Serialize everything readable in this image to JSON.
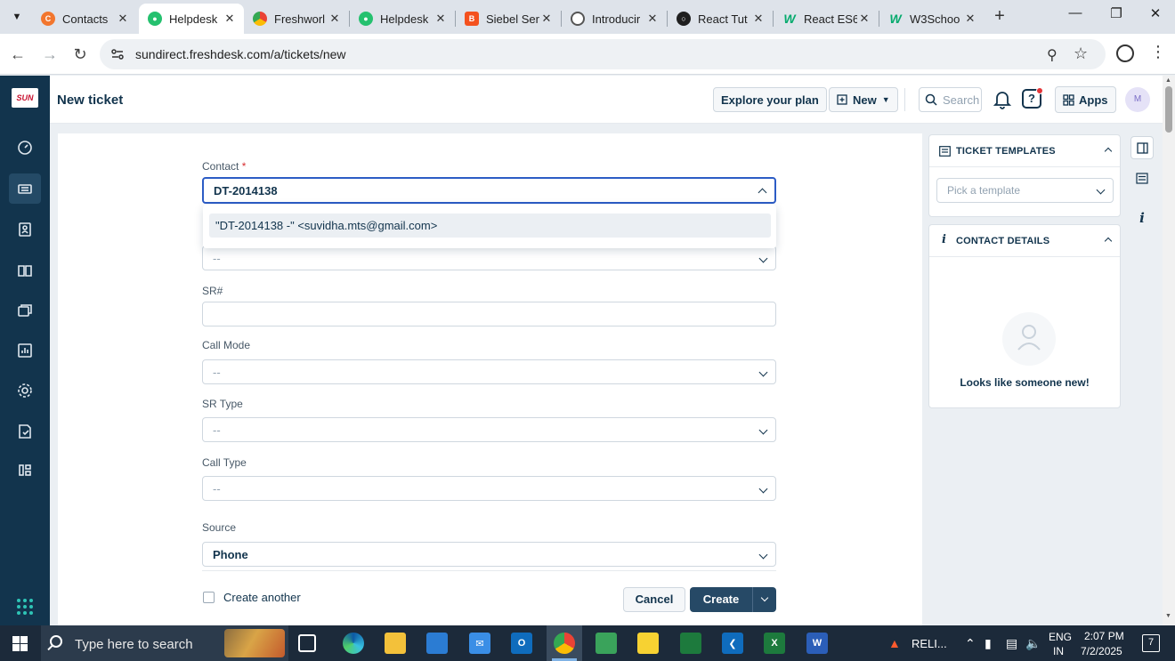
{
  "browser": {
    "tabs": [
      {
        "title": "Contacts",
        "favicon": "freshworks-orange-icon",
        "color": "#f2762e"
      },
      {
        "title": "Helpdesk",
        "favicon": "freshdesk-green-icon",
        "color": "#25c16f",
        "active": true
      },
      {
        "title": "Freshworl",
        "favicon": "chrome-color-icon",
        "color": "#4285f4"
      },
      {
        "title": "Helpdesk",
        "favicon": "freshdesk-green-icon",
        "color": "#25c16f"
      },
      {
        "title": "Siebel Ser",
        "favicon": "blogger-orange-icon",
        "color": "#f4511e"
      },
      {
        "title": "Introducir",
        "favicon": "openai-icon",
        "color": "#555555"
      },
      {
        "title": "React Tut",
        "favicon": "dark-circle-icon",
        "color": "#1f1f1f"
      },
      {
        "title": "React ES6",
        "favicon": "w3schools-icon",
        "color": "#04aa6d"
      },
      {
        "title": "W3Schoo",
        "favicon": "w3schools-icon",
        "color": "#04aa6d"
      }
    ],
    "url": "sundirect.freshdesk.com/a/tickets/new"
  },
  "header": {
    "title": "New ticket",
    "explore_label": "Explore your plan",
    "new_label": "New",
    "search_placeholder": "Search",
    "apps_label": "Apps",
    "avatar_initial": "M"
  },
  "sidebar": {
    "logo_text": "SUN",
    "icons": [
      "dashboard-icon",
      "tickets-icon",
      "contacts-icon",
      "knowledge-base-icon",
      "forums-icon",
      "reports-icon",
      "admin-gear-icon",
      "tasks-icon",
      "apps-icon"
    ]
  },
  "form": {
    "contact_label": "Contact",
    "contact_value": "DT-2014138",
    "suggestion": "\"DT-2014138 -\" <suvidha.mts@gmail.com>",
    "hidden_field_value": "--",
    "sr_label": "SR#",
    "sr_value": "",
    "call_mode_label": "Call Mode",
    "call_mode_value": "--",
    "sr_type_label": "SR Type",
    "sr_type_value": "--",
    "call_type_label": "Call Type",
    "call_type_value": "--",
    "source_label": "Source",
    "source_value": "Phone",
    "create_another_label": "Create another",
    "cancel_label": "Cancel",
    "create_label": "Create"
  },
  "right_panel": {
    "templates_title": "TICKET TEMPLATES",
    "template_placeholder": "Pick a template",
    "contact_details_title": "CONTACT DETAILS",
    "empty_text": "Looks like someone new!"
  },
  "taskbar": {
    "search_placeholder": "Type here to search",
    "reliance_label": "RELI...",
    "lang_line1": "ENG",
    "lang_line2": "IN",
    "time": "2:07 PM",
    "date": "7/2/2025",
    "notification_count": "7"
  },
  "colors": {
    "nav_bg": "#12344d",
    "primary_button": "#264966",
    "focus_border": "#2c5cc5",
    "required": "#d72d30"
  }
}
